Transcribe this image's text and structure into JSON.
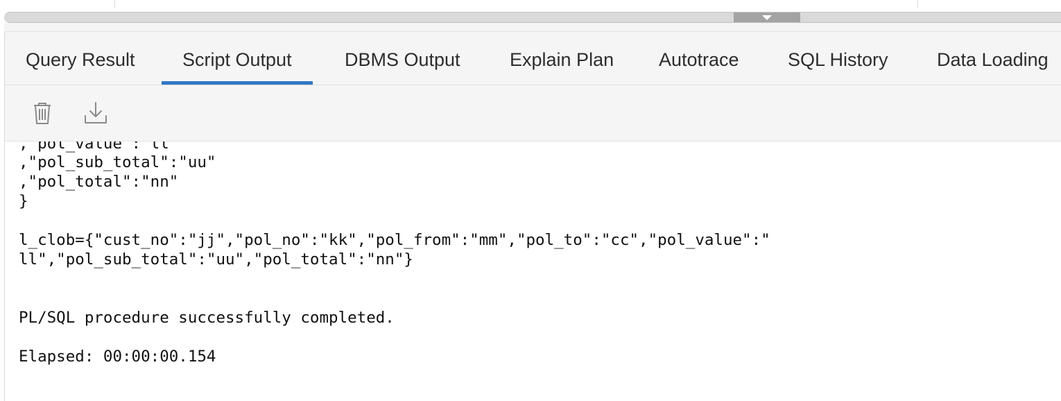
{
  "tabs": [
    {
      "label": "Query Result",
      "active": false
    },
    {
      "label": "Script Output",
      "active": true
    },
    {
      "label": "DBMS Output",
      "active": false
    },
    {
      "label": "Explain Plan",
      "active": false
    },
    {
      "label": "Autotrace",
      "active": false
    },
    {
      "label": "SQL History",
      "active": false
    },
    {
      "label": "Data Loading",
      "active": false
    }
  ],
  "toolbar": {
    "clear_icon": "trash-icon",
    "download_icon": "download-icon"
  },
  "splitter": {
    "handle_icon": "chevron-down-icon"
  },
  "output": {
    "lines": [
      ",\"pol_value\":\"ll\"",
      ",\"pol_sub_total\":\"uu\"",
      ",\"pol_total\":\"nn\"",
      "}",
      "",
      "l_clob={\"cust_no\":\"jj\",\"pol_no\":\"kk\",\"pol_from\":\"mm\",\"pol_to\":\"cc\",\"pol_value\":\"",
      "ll\",\"pol_sub_total\":\"uu\",\"pol_total\":\"nn\"}",
      "",
      "",
      "",
      "PL/SQL procedure successfully completed.",
      "",
      "Elapsed: 00:00:00.154"
    ]
  },
  "colors": {
    "active_tab_underline": "#3277c6",
    "tabbar_bg": "#f5f5f5",
    "text": "#2d2d2d"
  }
}
